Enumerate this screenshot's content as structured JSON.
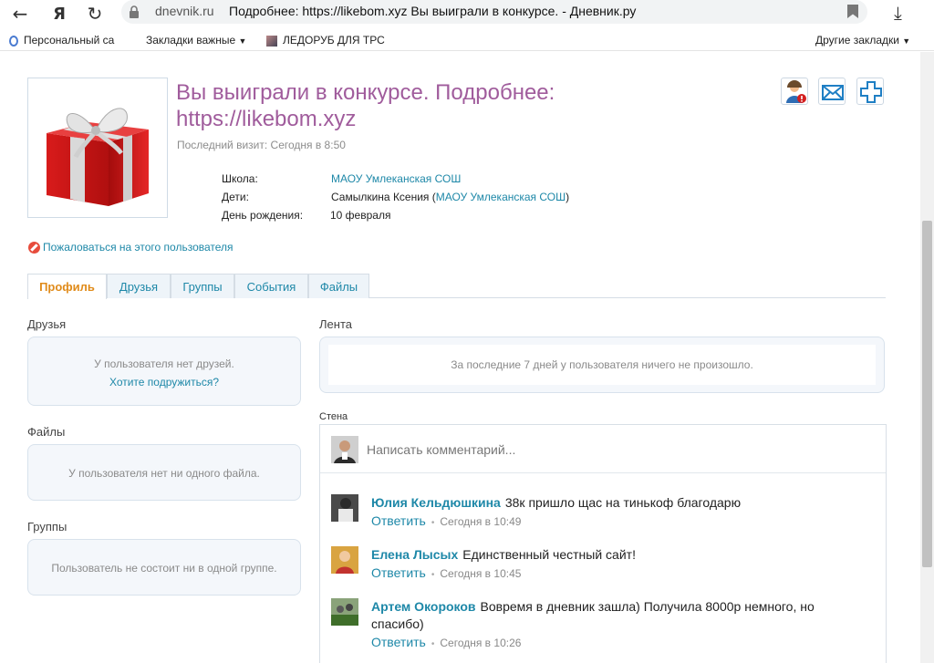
{
  "browser": {
    "domain": "dnevnik.ru",
    "page_title": "Подробнее: https://likebom.xyz Вы выиграли в конкурсе. - Дневник.ру",
    "ya_label": "Я",
    "bookmarks": [
      {
        "label": "Персональный са"
      },
      {
        "label": "Закладки важные"
      },
      {
        "label": "ЛЕДОРУБ ДЛЯ ТРС"
      }
    ],
    "other_bookmarks": "Другие закладки"
  },
  "profile": {
    "name": "Вы выиграли в конкурсе. Подробнее: https://likebom.xyz",
    "last_visit": "Последний визит: Сегодня в 8:50",
    "school_label": "Школа:",
    "school_value": "МАОУ Умлеканская СОШ",
    "children_label": "Дети:",
    "children_name": "Самылкина Ксения",
    "children_school": "МАОУ Умлеканская СОШ",
    "birthday_label": "День рождения:",
    "birthday_value": "10 февраля",
    "complain": "Пожаловаться на этого пользователя"
  },
  "tabs": [
    {
      "label": "Профиль",
      "active": true
    },
    {
      "label": "Друзья",
      "active": false
    },
    {
      "label": "Группы",
      "active": false
    },
    {
      "label": "События",
      "active": false
    },
    {
      "label": "Файлы",
      "active": false
    }
  ],
  "friends": {
    "title": "Друзья",
    "empty": "У пользователя нет друзей.",
    "link": "Хотите подружиться?"
  },
  "files": {
    "title": "Файлы",
    "empty": "У пользователя нет ни одного файла."
  },
  "groups": {
    "title": "Группы",
    "empty": "Пользователь не состоит ни в одной группе."
  },
  "feed": {
    "title": "Лента",
    "empty": "За последние 7 дней у пользователя ничего не произошло."
  },
  "wall": {
    "title": "Стена",
    "placeholder": "Написать комментарий...",
    "posts": [
      {
        "author": "Юлия Кельдюшкина",
        "text": "38к пришло щас на тинькоф благодарю",
        "reply": "Ответить",
        "time": "Сегодня в 10:49"
      },
      {
        "author": "Елена Лысых",
        "text": "Единственный честный сайт!",
        "reply": "Ответить",
        "time": "Сегодня в 10:45"
      },
      {
        "author": "Артем Окороков",
        "text": "Вовремя в дневник зашла) Получила 8000р немного, но спасибо)",
        "reply": "Ответить",
        "time": "Сегодня в 10:26"
      }
    ]
  },
  "colors": {
    "profile_name": "#a05c9c",
    "link": "#1e88a8",
    "active_tab": "#e08b1a"
  }
}
